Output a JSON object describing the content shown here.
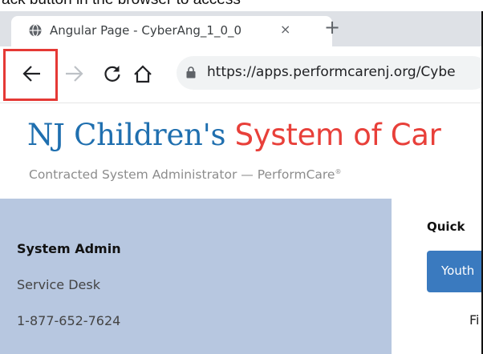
{
  "top_strip_text": "ack button in the browser to access",
  "browser": {
    "tab_title": "Angular Page - CyberAng_1_0_0",
    "tab_close": "×",
    "new_tab": "+",
    "url": "https://apps.performcarenj.org/Cybe"
  },
  "site": {
    "title_nj": "NJ Children's",
    "title_system": " System of Car",
    "subtitle": "Contracted System Administrator — PerformCare",
    "subtitle_mark": "®",
    "brand_blue": "#1f6faf",
    "brand_red": "#e8403a"
  },
  "sidebar": {
    "heading": "System Admin",
    "service": "Service Desk",
    "phone": "1-877-652-7624"
  },
  "main": {
    "quick_heading": "Quick",
    "youth_button": "Youth",
    "partial_text": "Fi"
  },
  "icons": [
    "globe-icon",
    "close-icon",
    "plus-icon",
    "back-arrow-icon",
    "forward-arrow-icon",
    "reload-icon",
    "home-icon",
    "lock-icon"
  ],
  "highlight_color": "#e53935"
}
